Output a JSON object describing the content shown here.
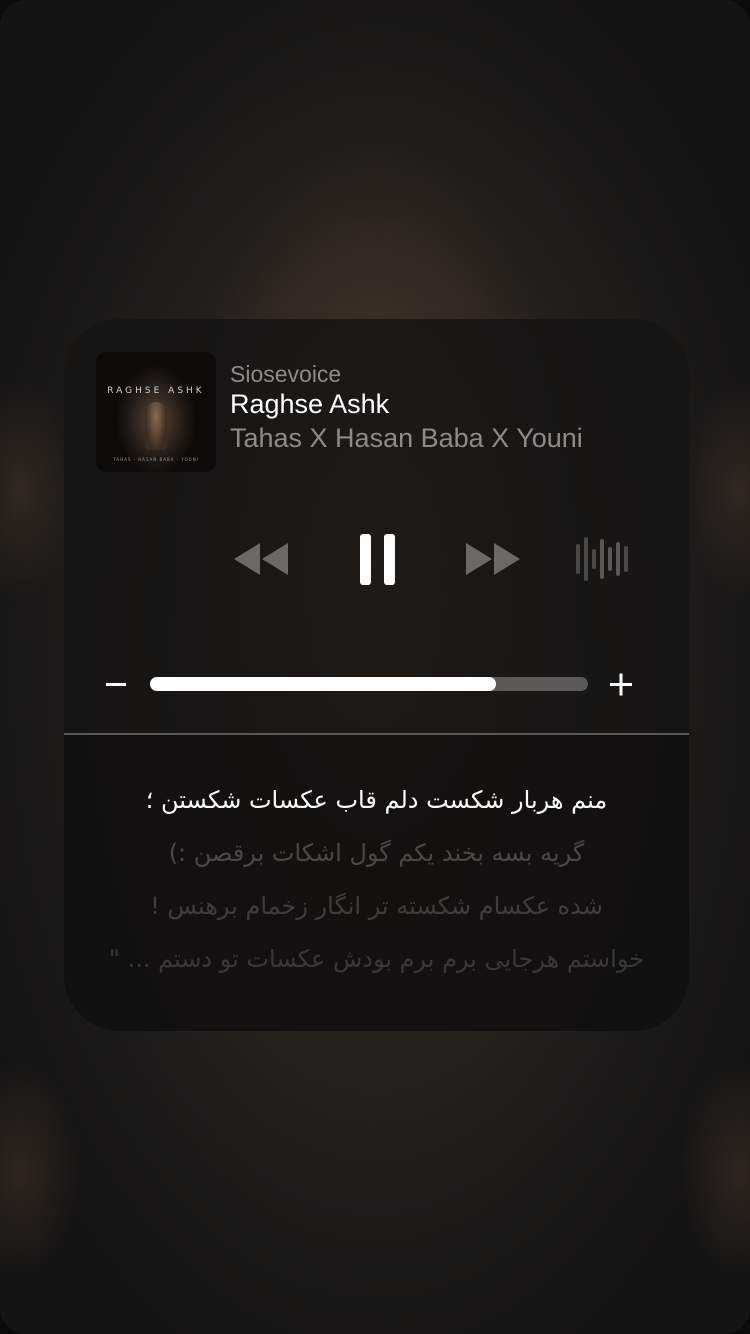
{
  "now_playing": {
    "source": "Siosevoice",
    "title": "Raghse Ashk",
    "artist": "Tahas X Hasan Baba X Youni",
    "artwork": {
      "title": "RAGHSE ASHK",
      "caption": "TAHAS · HASAN BABA · YOUNI"
    }
  },
  "controls": {
    "rewind_icon": "rewind-icon",
    "pause_icon": "pause-icon",
    "forward_icon": "fast-forward-icon",
    "waveform_icon": "waveform-icon",
    "state": "playing"
  },
  "volume": {
    "minus_label": "−",
    "plus_label": "+",
    "level_fraction": 0.79
  },
  "lyrics": {
    "lines": [
      "منم هربار شکست دلم قاب عکسات شکستن ؛",
      "گریه بسه بخند یکم گول اشکات برقصن :)",
      "شده عکسام شکسته تر انگار زخمام برهنس !",
      "خواستم هرجایی برم برم بودش عکسات تو دستم ... \""
    ],
    "active_index": 0
  },
  "colors": {
    "card_background": "#161515",
    "primary_text": "#ffffff",
    "secondary_text": "#8e8b88",
    "inactive_control": "#6b6967",
    "volume_track": "#5b5957",
    "volume_fill": "#ffffff"
  }
}
